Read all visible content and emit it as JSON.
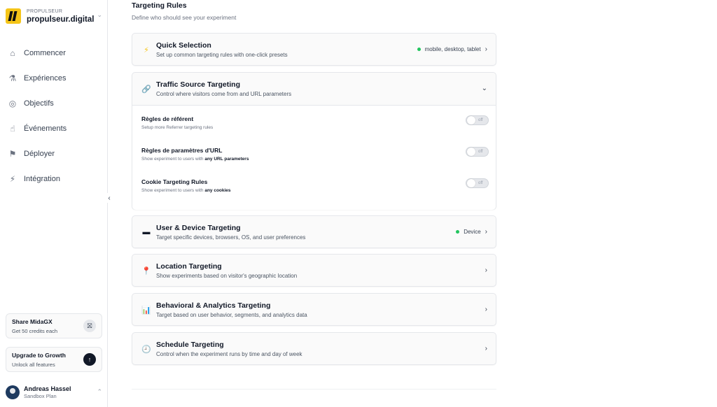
{
  "sidebar": {
    "brand": {
      "eyebrow": "PROPULSEUR",
      "name": "propulseur.digital"
    },
    "nav": [
      {
        "label": "Commencer",
        "icon": "home-icon",
        "glyph": "⌂"
      },
      {
        "label": "Expériences",
        "icon": "flask-icon",
        "glyph": "⚗"
      },
      {
        "label": "Objectifs",
        "icon": "target-icon",
        "glyph": "◎"
      },
      {
        "label": "Événements",
        "icon": "click-icon",
        "glyph": "☝"
      },
      {
        "label": "Déployer",
        "icon": "deploy-icon",
        "glyph": "⚑"
      },
      {
        "label": "Intégration",
        "icon": "plug-icon",
        "glyph": "⚡"
      }
    ],
    "share": {
      "title": "Share MidaGX",
      "sub": "Get 50 credits each"
    },
    "upgrade": {
      "title": "Upgrade to Growth",
      "sub": "Unlock all features"
    },
    "user": {
      "name": "Andreas Hassel",
      "plan": "Sandbox Plan"
    }
  },
  "main": {
    "title": "Targeting Rules",
    "subtitle": "Define who should see your experiment",
    "sections": {
      "quick": {
        "title": "Quick Selection",
        "desc": "Set up common targeting rules with one-click presets",
        "status": "mobile, desktop, tablet"
      },
      "traffic": {
        "title": "Traffic Source Targeting",
        "desc": "Control where visitors come from and URL parameters"
      },
      "device": {
        "title": "User & Device Targeting",
        "desc": "Target specific devices, browsers, OS, and user preferences",
        "status": "Device"
      },
      "location": {
        "title": "Location Targeting",
        "desc": "Show experiments based on visitor's geographic location"
      },
      "behavior": {
        "title": "Behavioral & Analytics Targeting",
        "desc": "Target based on user behavior, segments, and analytics data"
      },
      "schedule": {
        "title": "Schedule Targeting",
        "desc": "Control when the experiment runs by time and day of week"
      }
    },
    "rules": {
      "referrer": {
        "title": "Règles de référent",
        "desc": "Setup more Referrer targeting rules",
        "toggle": "off"
      },
      "url": {
        "title": "Règles de paramètres d'URL",
        "desc_prefix": "Show experiment to users with ",
        "desc_bold": "any URL parameters",
        "toggle": "off"
      },
      "cookie": {
        "title": "Cookie Targeting Rules",
        "desc_prefix": "Show experiment to users with ",
        "desc_bold": "any cookies",
        "toggle": "off"
      }
    }
  },
  "colors": {
    "status_green": "#22c55e",
    "brand_yellow": "#f5c518"
  }
}
